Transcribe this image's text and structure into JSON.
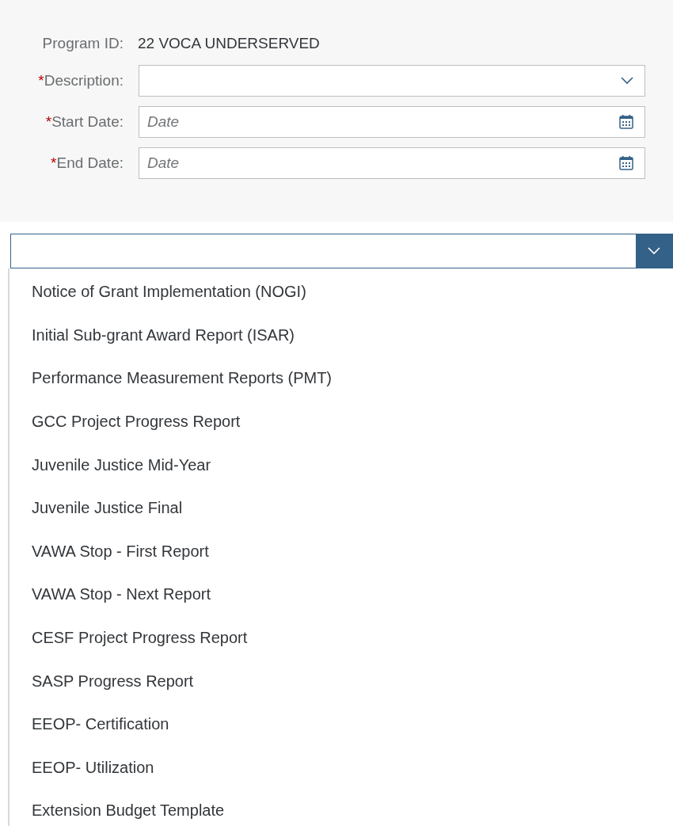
{
  "form": {
    "program_id": {
      "label": "Program ID:",
      "value": "22 VOCA UNDERSERVED"
    },
    "fields": [
      {
        "kind": "select",
        "label": "Description:",
        "required": true
      },
      {
        "kind": "date",
        "label": "Start Date:",
        "required": true,
        "placeholder": "Date"
      },
      {
        "kind": "date",
        "label": "End Date:",
        "required": true,
        "placeholder": "Date"
      }
    ],
    "required_mark": "*"
  },
  "report_select": {
    "expanded": true,
    "options": [
      {
        "label": "Notice of Grant Implementation (NOGI)"
      },
      {
        "label": "Initial Sub-grant Award Report (ISAR)"
      },
      {
        "label": "Performance Measurement Reports (PMT)"
      },
      {
        "label": "GCC Project Progress Report"
      },
      {
        "label": "Juvenile Justice Mid-Year"
      },
      {
        "label": "Juvenile Justice Final"
      },
      {
        "label": "VAWA Stop - First Report"
      },
      {
        "label": "VAWA Stop - Next Report"
      },
      {
        "label": "CESF Project Progress Report"
      },
      {
        "label": "SASP Progress Report"
      },
      {
        "label": "EEOP- Certification"
      },
      {
        "label": "EEOP- Utilization"
      },
      {
        "label": "Extension Budget Template"
      }
    ]
  }
}
